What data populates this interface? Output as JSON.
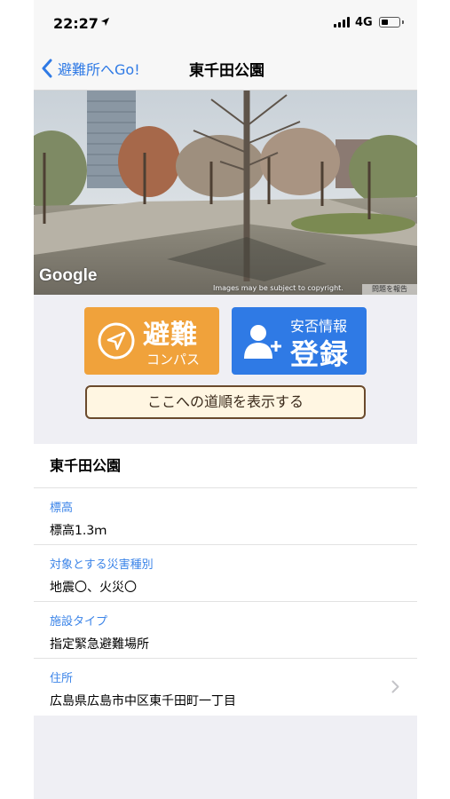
{
  "status_bar": {
    "time": "22:27",
    "network": "4G",
    "battery_level": 0.4,
    "icons": [
      "location-arrow-icon",
      "signal-icon",
      "battery-icon"
    ]
  },
  "nav": {
    "back_label": "避難所へGo!",
    "title": "東千田公園",
    "accent_color": "#2f7ae5"
  },
  "street_view": {
    "logo": "Google",
    "copyright": "Images may be subject to copyright.",
    "report_label": "問題を報告"
  },
  "actions": {
    "compass_button": {
      "title": "避難",
      "subtitle": "コンパス",
      "color": "#f0a23b",
      "icon": "compass-arrow-icon"
    },
    "register_button": {
      "subtitle": "安否情報",
      "title": "登録",
      "color": "#2f7ae5",
      "icon": "person-add-icon"
    },
    "directions_button": "ここへの道順を表示する"
  },
  "info": {
    "name": "東千田公園",
    "rows": [
      {
        "label": "標高",
        "value": "標高1.3ｍ"
      },
      {
        "label": "対象とする災害種別",
        "value": "地震〇、火災〇"
      },
      {
        "label": "施設タイプ",
        "value": "指定緊急避難場所"
      },
      {
        "label": "住所",
        "value": "広島県広島市中区東千田町一丁目",
        "icon": "chevron-right-icon"
      }
    ]
  }
}
